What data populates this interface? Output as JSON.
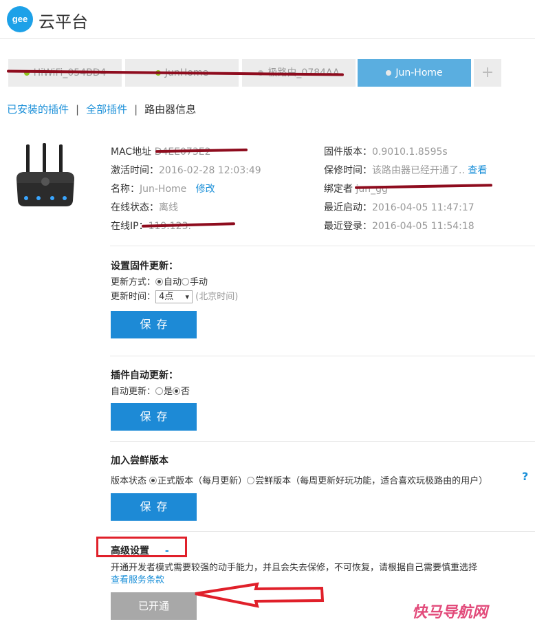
{
  "header": {
    "logo_text": "gee",
    "brand": "云平台"
  },
  "tabs": [
    {
      "label": "HiWiFi_054BD4",
      "active": false
    },
    {
      "label": "JunHome",
      "active": false
    },
    {
      "label": "极路由_0784AA",
      "active": false
    },
    {
      "label": "Jun-Home",
      "active": true
    },
    {
      "label": "+",
      "active": false
    }
  ],
  "subnav": {
    "installed": "已安装的插件",
    "all": "全部插件",
    "router_info": "路由器信息",
    "sep": "|"
  },
  "router": {
    "mac_label": "MAC地址",
    "mac_value": "D4EE073E2",
    "activated_label": "激活时间：",
    "activated_value": "2016-02-28 12:03:49",
    "name_label": "名称：",
    "name_value": "Jun-Home",
    "name_edit": "修改",
    "status_label": "在线状态：",
    "status_value": "离线",
    "ip_label": "在线IP：",
    "ip_value": "119.123.",
    "firmware_label": "固件版本：",
    "firmware_value": "0.9010.1.8595s",
    "warranty_label": "保修时间：",
    "warranty_value": "该路由器已经开通了..",
    "warranty_link": "查看",
    "binder_label": "绑定者",
    "binder_value": "jun_gg",
    "last_boot_label": "最近启动：",
    "last_boot_value": "2016-04-05 11:47:17",
    "last_login_label": "最近登录：",
    "last_login_value": "2016-04-05 11:54:18"
  },
  "firmware_update": {
    "title": "设置固件更新：",
    "mode_label": "更新方式：",
    "mode_auto": "自动",
    "mode_manual": "手动",
    "mode_selected": "auto",
    "time_label": "更新时间：",
    "time_value": "4点",
    "time_note": "(北京时间)",
    "save": "保存"
  },
  "plugin_update": {
    "title": "插件自动更新：",
    "label": "自动更新：",
    "yes": "是",
    "no": "否",
    "selected": "no",
    "save": "保存"
  },
  "beta": {
    "title": "加入尝鲜版本",
    "label": "版本状态",
    "stable": "正式版本（每月更新）",
    "beta": "尝鲜版本（每周更新好玩功能，适合喜欢玩极路由的用户）",
    "selected": "stable",
    "help": "?",
    "save": "保存"
  },
  "advanced": {
    "title": "高级设置",
    "collapse": "-",
    "desc": "开通开发者模式需要较强的动手能力，并且会失去保修，不可恢复，请根据自己需要慎重选择",
    "terms_link": "查看服务条款",
    "status_button": "已开通"
  },
  "watermark": "快马导航网",
  "colors": {
    "accent": "#1d8ad6",
    "active_tab": "#5aaee0",
    "annotation_red": "#e0202a",
    "scribble": "#8e0c1e"
  }
}
